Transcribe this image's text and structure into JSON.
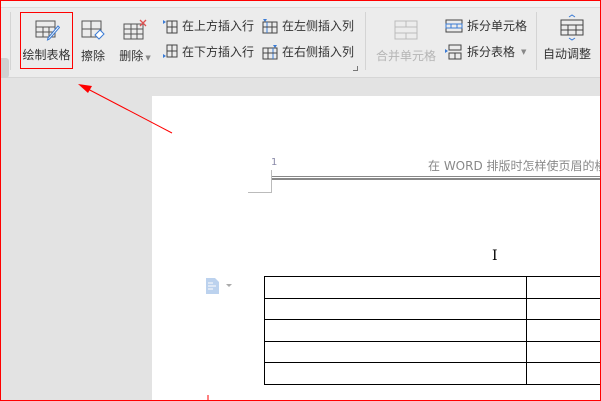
{
  "toolbar": {
    "draw_table": "绘制表格",
    "erase": "擦除",
    "delete": "删除",
    "insert_above": "在上方插入行",
    "insert_below": "在下方插入行",
    "insert_left": "在左侧插入列",
    "insert_right": "在右侧插入列",
    "merge_cells": "合并单元格",
    "split_cells": "拆分单元格",
    "split_table": "拆分表格",
    "auto_fit": "自动调整"
  },
  "document": {
    "header_page_number": "1",
    "header_text": "在 WORD 排版时怎样使页眉的横",
    "table_rows": 5,
    "table_cols": 2
  },
  "colors": {
    "annotation": "#ff0000",
    "icon_blue": "#3a7bd5"
  }
}
